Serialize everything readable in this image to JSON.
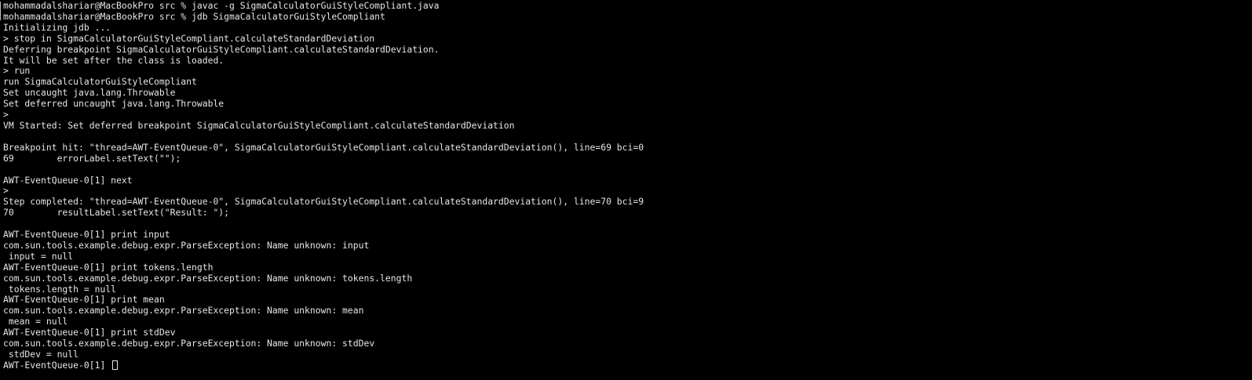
{
  "terminal": {
    "lines": [
      "mohammadalshariar@MacBookPro src % javac -g SigmaCalculatorGuiStyleCompliant.java",
      "mohammadalshariar@MacBookPro src % jdb SigmaCalculatorGuiStyleCompliant",
      "Initializing jdb ...",
      "> stop in SigmaCalculatorGuiStyleCompliant.calculateStandardDeviation",
      "Deferring breakpoint SigmaCalculatorGuiStyleCompliant.calculateStandardDeviation.",
      "It will be set after the class is loaded.",
      "> run",
      "run SigmaCalculatorGuiStyleCompliant",
      "Set uncaught java.lang.Throwable",
      "Set deferred uncaught java.lang.Throwable",
      ">",
      "VM Started: Set deferred breakpoint SigmaCalculatorGuiStyleCompliant.calculateStandardDeviation",
      "",
      "Breakpoint hit: \"thread=AWT-EventQueue-0\", SigmaCalculatorGuiStyleCompliant.calculateStandardDeviation(), line=69 bci=0",
      "69        errorLabel.setText(\"\");",
      "",
      "AWT-EventQueue-0[1] next",
      ">",
      "Step completed: \"thread=AWT-EventQueue-0\", SigmaCalculatorGuiStyleCompliant.calculateStandardDeviation(), line=70 bci=9",
      "70        resultLabel.setText(\"Result: \");",
      "",
      "AWT-EventQueue-0[1] print input",
      "com.sun.tools.example.debug.expr.ParseException: Name unknown: input",
      " input = null",
      "AWT-EventQueue-0[1] print tokens.length",
      "com.sun.tools.example.debug.expr.ParseException: Name unknown: tokens.length",
      " tokens.length = null",
      "AWT-EventQueue-0[1] print mean",
      "com.sun.tools.example.debug.expr.ParseException: Name unknown: mean",
      " mean = null",
      "AWT-EventQueue-0[1] print stdDev",
      "com.sun.tools.example.debug.expr.ParseException: Name unknown: stdDev",
      " stdDev = null"
    ],
    "current_prompt": "AWT-EventQueue-0[1]",
    "colors": {
      "background": "#000000",
      "foreground": "#e6e6e6"
    }
  }
}
